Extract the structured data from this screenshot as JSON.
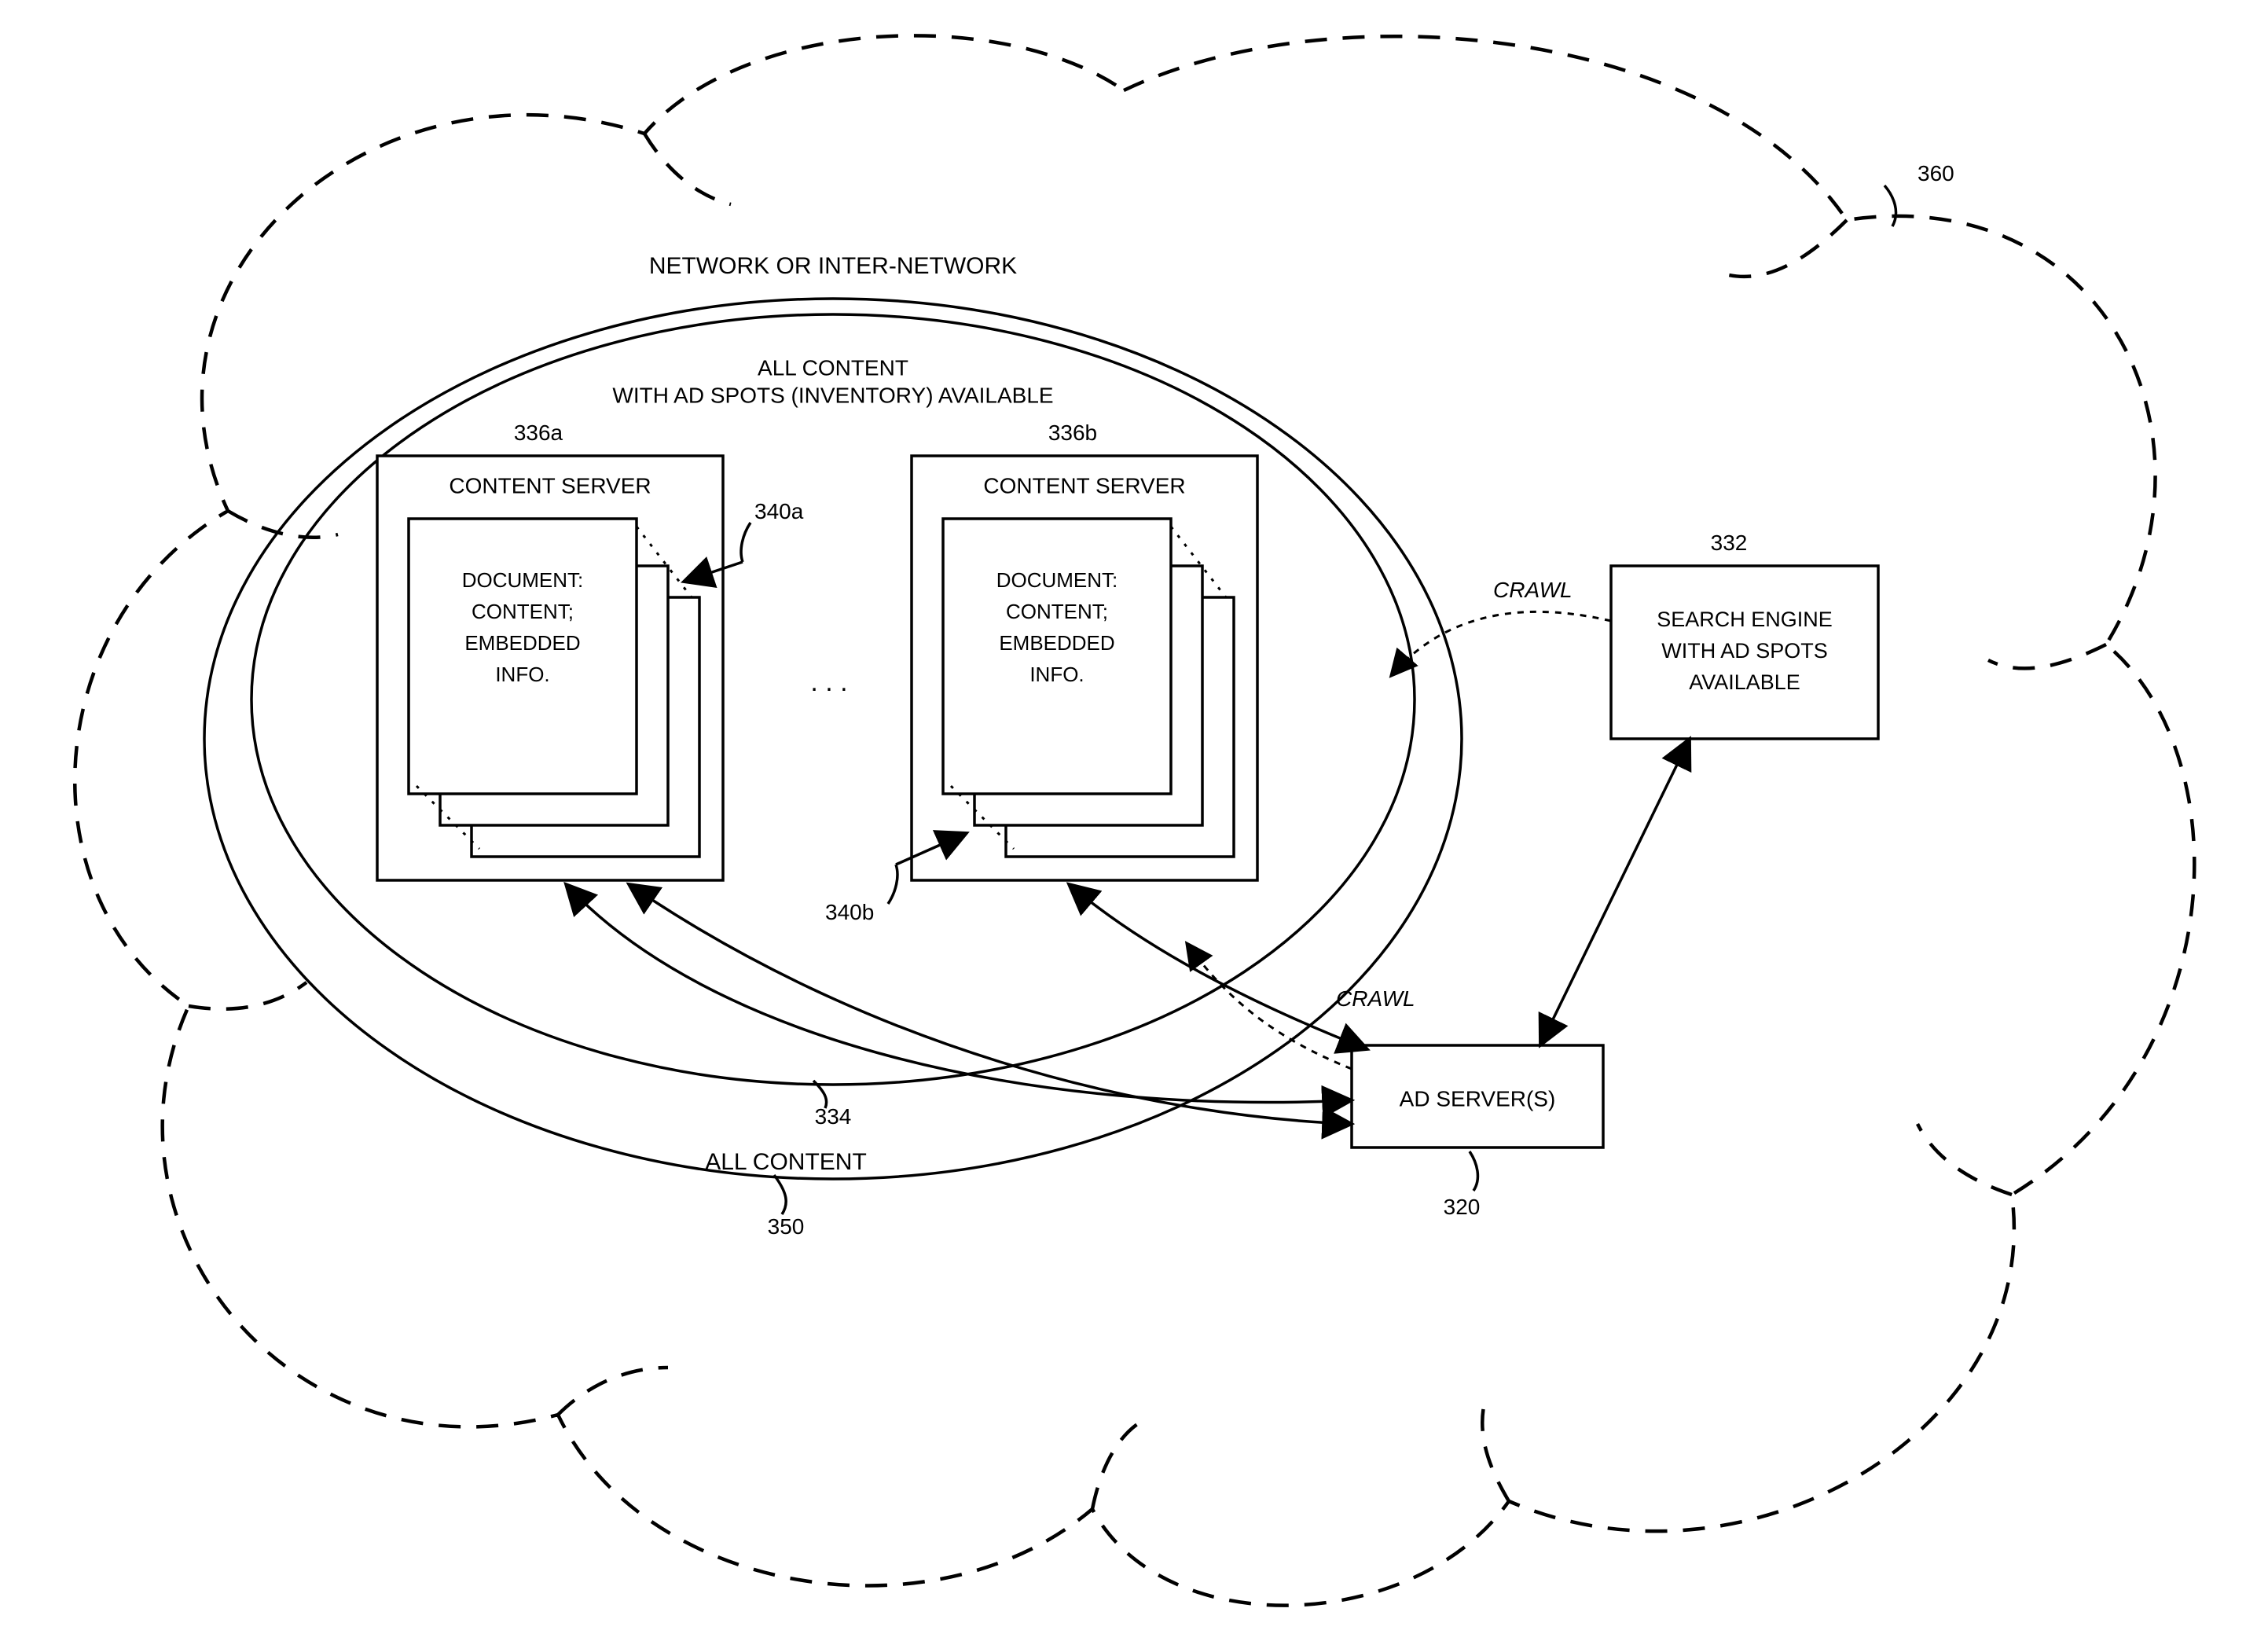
{
  "labels": {
    "network": "NETWORK OR INTER-NETWORK",
    "all_content_inventory_line1": "ALL CONTENT",
    "all_content_inventory_line2": "WITH AD SPOTS (INVENTORY) AVAILABLE",
    "content_server_a": "CONTENT SERVER",
    "content_server_b": "CONTENT SERVER",
    "doc_line1": "DOCUMENT:",
    "doc_line2": "CONTENT;",
    "doc_line3": "EMBEDDED",
    "doc_line4": "INFO.",
    "search_line1": "SEARCH ENGINE",
    "search_line2": "WITH AD SPOTS",
    "search_line3": "AVAILABLE",
    "ad_server": "AD SERVER(S)",
    "all_content": "ALL CONTENT",
    "crawl": "CRAWL"
  },
  "refs": {
    "cloud": "360",
    "search": "332",
    "adserver": "320",
    "inner_ellipse": "334",
    "outer_ellipse": "350",
    "cs_a": "336a",
    "cs_b": "336b",
    "doc_a": "340a",
    "doc_b": "340b"
  },
  "ellipsis": ".  .  ."
}
